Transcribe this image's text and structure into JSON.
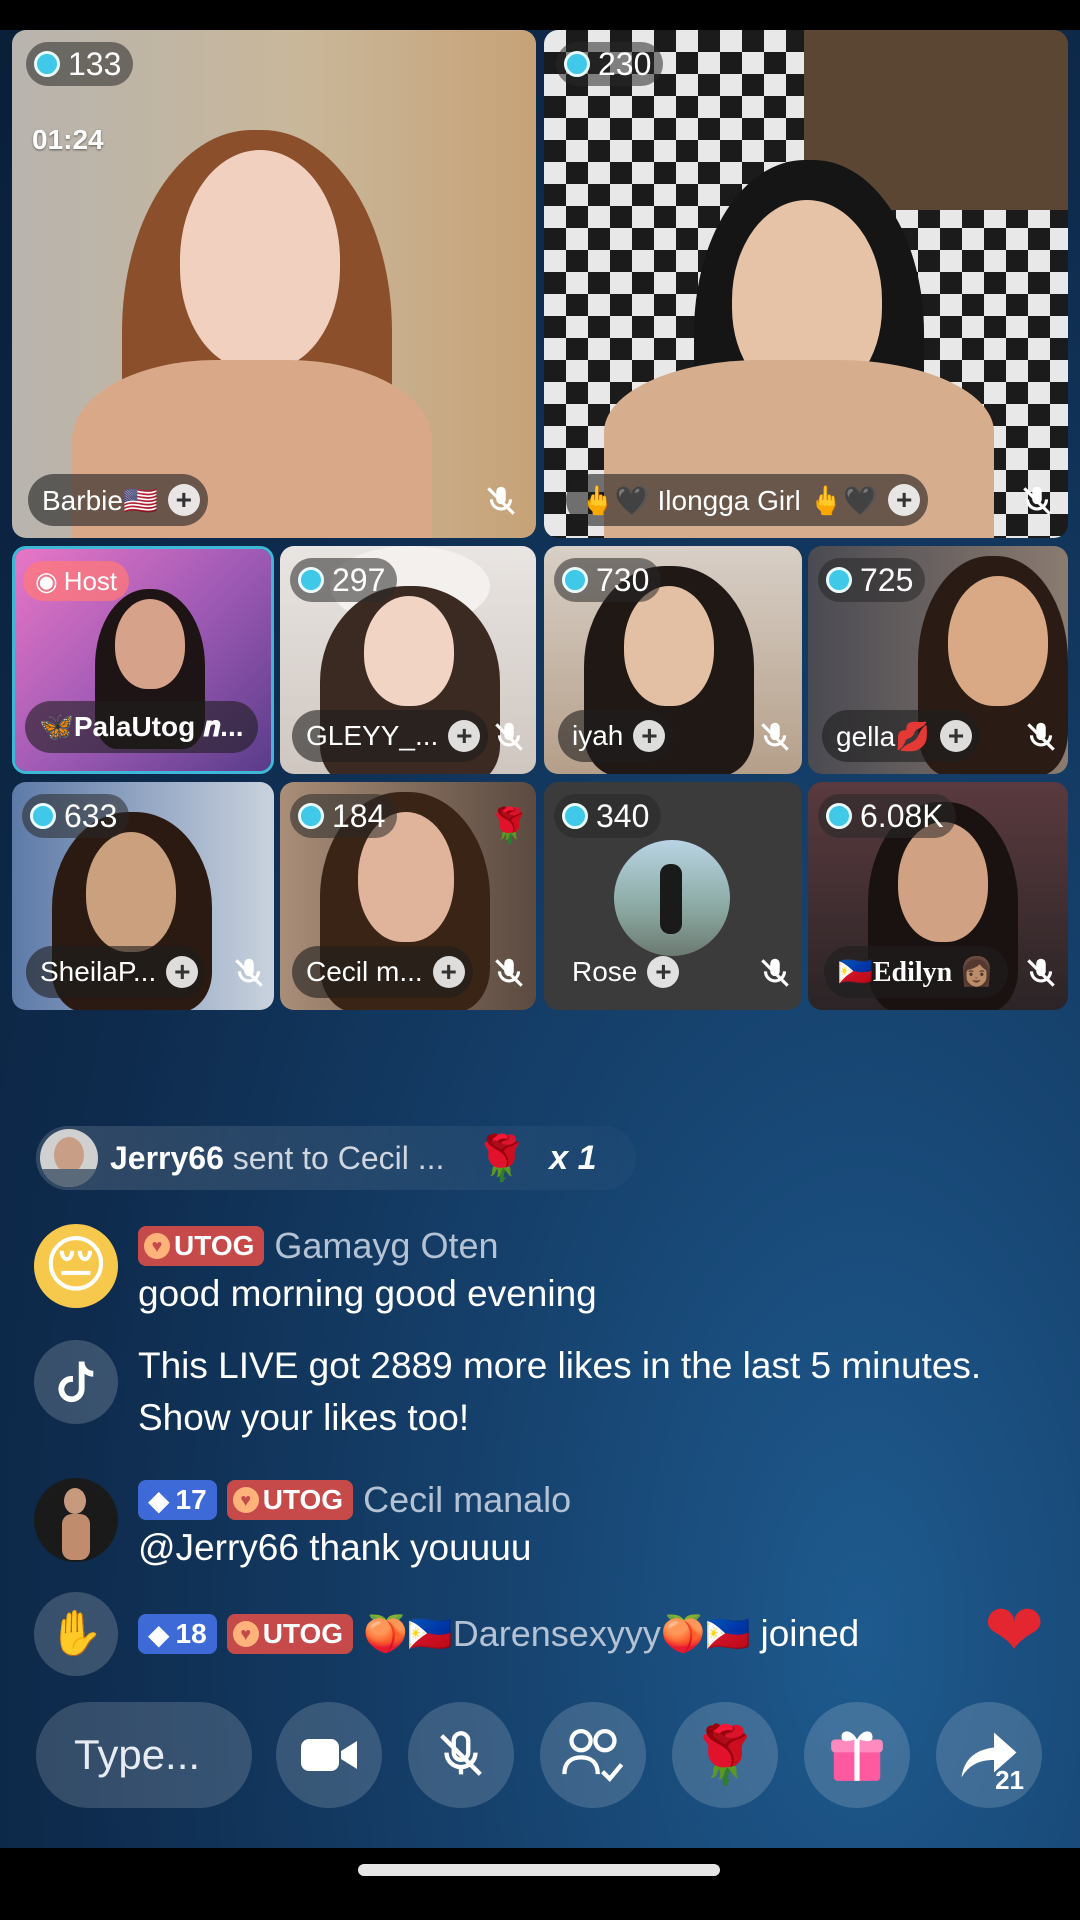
{
  "tiles": [
    {
      "id": "barbie",
      "name": "Barbie🇺🇸",
      "count": "133",
      "timer": "01:24"
    },
    {
      "id": "ilongga",
      "name": "🖕🖤 Ilongga Girl 🖕🖤",
      "count": "230"
    },
    {
      "id": "host",
      "name": "🦋PalaUtog 𝒏...",
      "host_label": "Host"
    },
    {
      "id": "gleyy",
      "name": "GLEYY_...",
      "count": "297"
    },
    {
      "id": "iyah",
      "name": "iyah",
      "count": "730"
    },
    {
      "id": "gella",
      "name": "gella💋",
      "count": "725"
    },
    {
      "id": "sheila",
      "name": "SheilaP...",
      "count": "633"
    },
    {
      "id": "cecil",
      "name": "Cecil m...",
      "count": "184"
    },
    {
      "id": "rose",
      "name": "Rose",
      "count": "340"
    },
    {
      "id": "edilyn",
      "name": "🇵🇭Edilyn 👩🏽",
      "count": "6.08K"
    }
  ],
  "gift_banner": {
    "user": "Jerry66",
    "text": "sent to Cecil ...",
    "gift_icon": "🌹",
    "multiplier": "x 1"
  },
  "chat": [
    {
      "avatar": "😔",
      "badges": [
        "UTOG"
      ],
      "user": "Gamayg Oten",
      "text": "good morning good evening"
    },
    {
      "avatar": "tiktok-icon",
      "user": "",
      "text": "This LIVE got 2889 more likes in the last 5 minutes. Show your likes too!"
    },
    {
      "avatar": "photo",
      "level": "17",
      "badges": [
        "UTOG"
      ],
      "user": "Cecil manalo",
      "text": "@Jerry66 thank youuuu"
    },
    {
      "avatar": "wave-icon",
      "level": "18",
      "badges": [
        "UTOG"
      ],
      "user": "🍑🇵🇭Darensexyyy🍑🇵🇭",
      "text": "joined"
    }
  ],
  "bottom_bar": {
    "type_placeholder": "Type...",
    "share_count": "21"
  },
  "colors": {
    "accent_gem": "#3fc8e8",
    "utog_badge": "#c64a4a",
    "level_badge": "#3d6ad6",
    "background": "#16426e"
  }
}
